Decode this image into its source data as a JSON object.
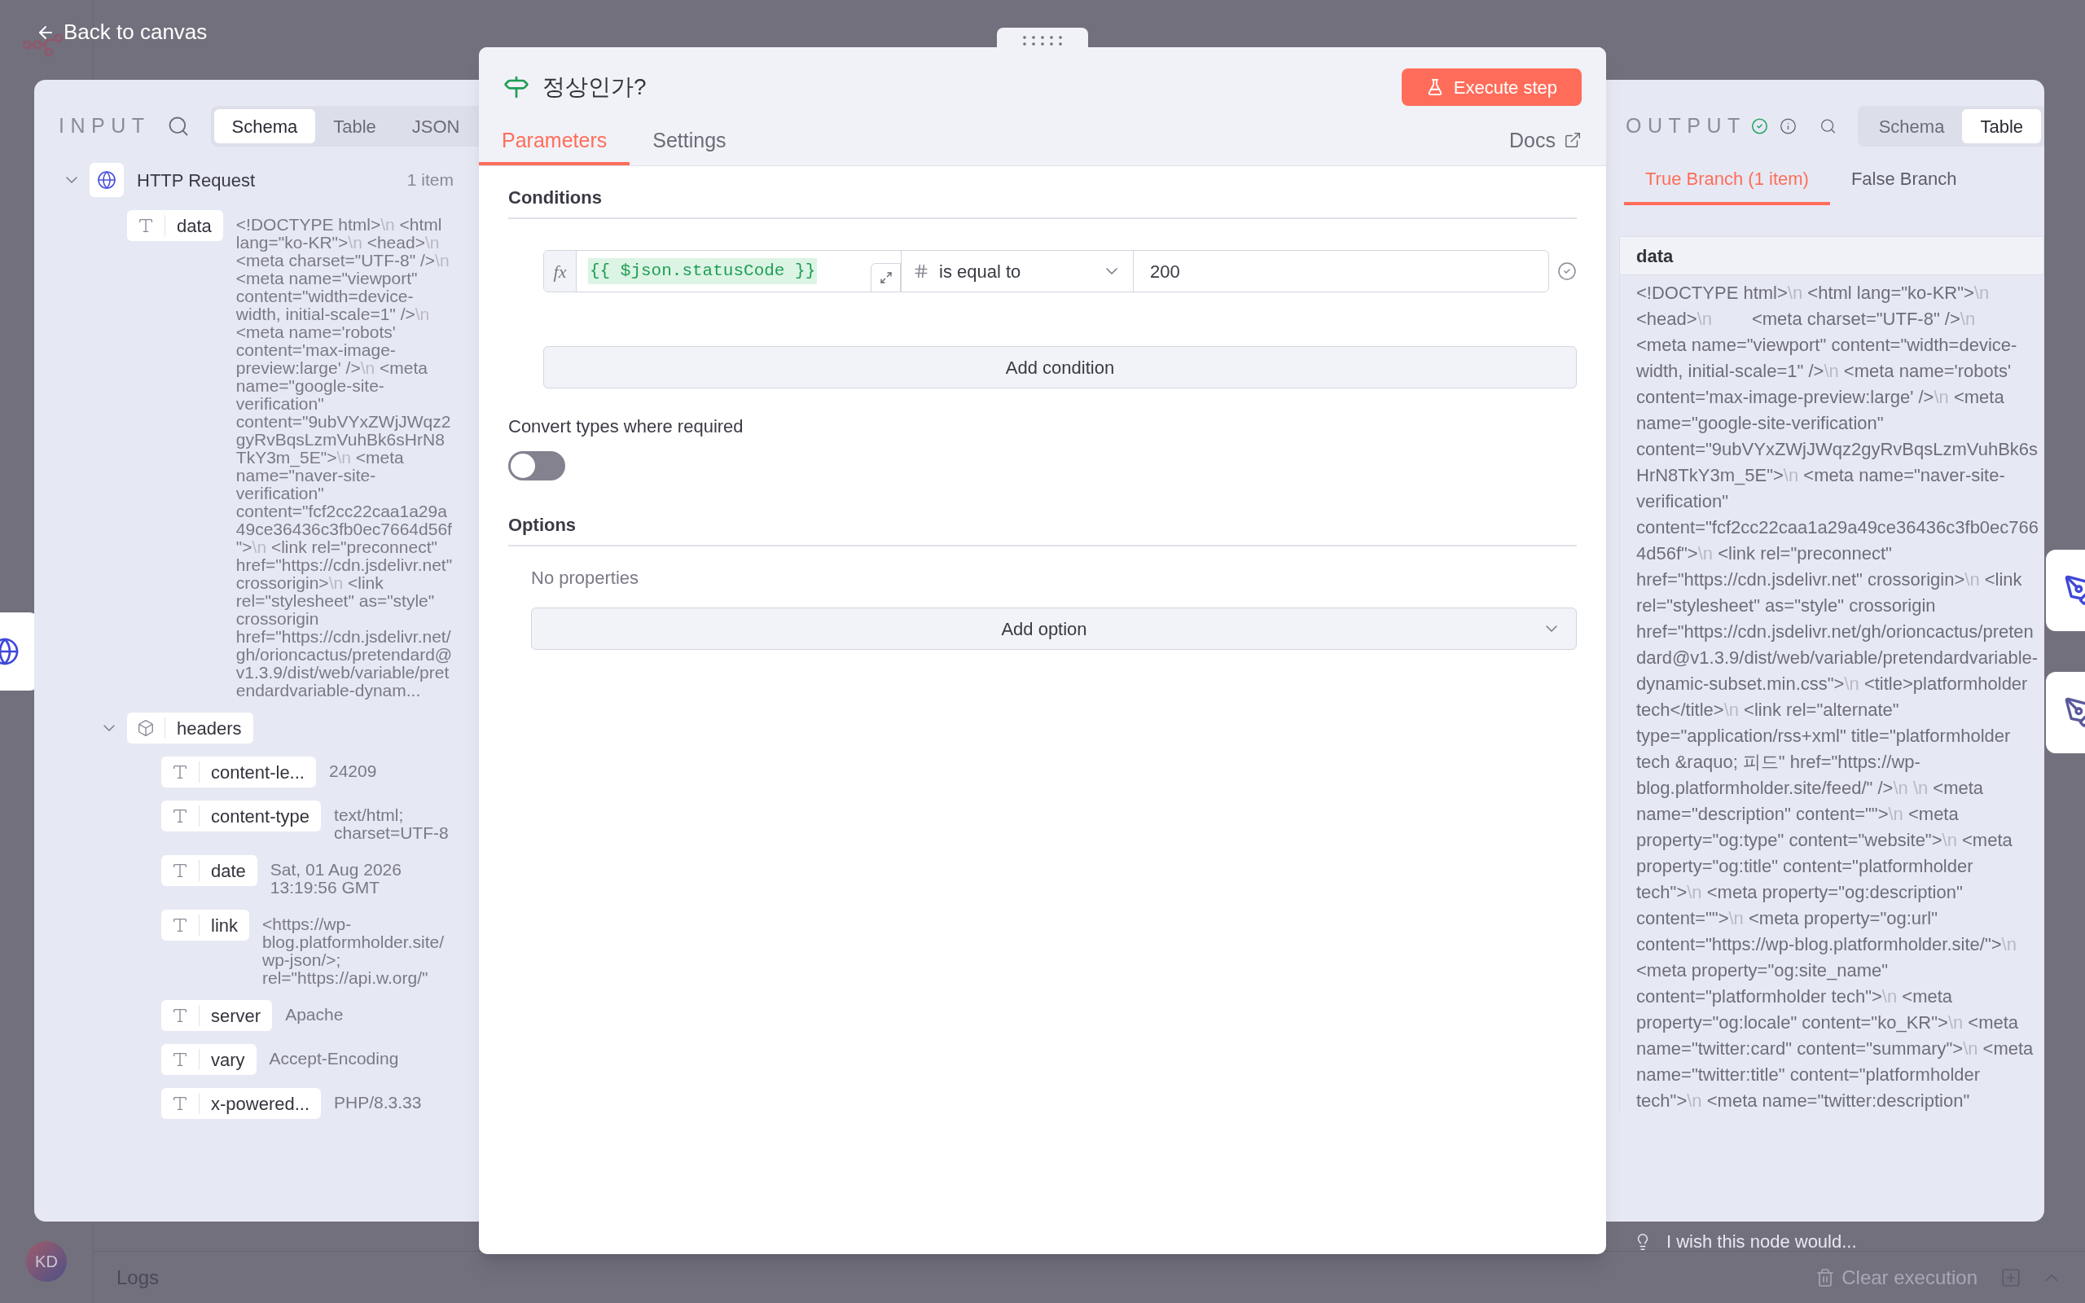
{
  "back_link": "Back to canvas",
  "input_panel": {
    "title": "INPUT",
    "view_tabs": [
      {
        "label": "Schema",
        "selected": true
      },
      {
        "label": "Table",
        "selected": false
      },
      {
        "label": "JSON",
        "selected": false
      }
    ],
    "tree": [
      {
        "kind": "node",
        "label": "HTTP Request",
        "count": "1 item",
        "expanded": true,
        "children": [
          {
            "kind": "text",
            "key": "data",
            "value": "<!DOCTYPE html>\\n <html lang=\"ko-KR\">\\n <head>\\n <meta charset=\"UTF-8\" />\\n <meta name=\"viewport\" content=\"width=device-width, initial-scale=1\" />\\n <meta name='robots' content='max-image-preview:large' />\\n <meta name=\"google-site-verification\" content=\"9ubVYxZWjJWqz2gyRvBqsLzmVuhBk6sHrN8TkY3m_5E\">\\n <meta name=\"naver-site-verification\" content=\"fcf2cc22caa1a29a49ce36436c3fb0ec7664d56f\">\\n <link rel=\"preconnect\" href=\"https://cdn.jsdelivr.net\" crossorigin>\\n <link rel=\"stylesheet\" as=\"style\" crossorigin href=\"https://cdn.jsdelivr.net/gh/orioncactus/pretendard@v1.3.9/dist/web/variable/pretendardvariable-dynam..."
          },
          {
            "kind": "object",
            "key": "headers",
            "expanded": true,
            "children": [
              {
                "kind": "text",
                "key": "content-le...",
                "value": "24209"
              },
              {
                "kind": "text",
                "key": "content-type",
                "value": "text/html; charset=UTF-8"
              },
              {
                "kind": "text",
                "key": "date",
                "value": "Sat, 01 Aug 2026 13:19:56 GMT"
              },
              {
                "kind": "text",
                "key": "link",
                "value": "<https://wp-blog.platformholder.site/wp-json/>; rel=\"https://api.w.org/\""
              },
              {
                "kind": "text",
                "key": "server",
                "value": "Apache"
              },
              {
                "kind": "text",
                "key": "vary",
                "value": "Accept-Encoding"
              },
              {
                "kind": "text",
                "key": "x-powered...",
                "value": "PHP/8.3.33"
              }
            ]
          }
        ]
      }
    ]
  },
  "node_editor": {
    "title": "정상인가?",
    "execute_button": "Execute step",
    "tabs": [
      {
        "label": "Parameters",
        "selected": true
      },
      {
        "label": "Settings",
        "selected": false
      }
    ],
    "docs_link": "Docs",
    "conditions": {
      "heading": "Conditions",
      "rows": [
        {
          "expression_marker": "fx",
          "left_value": "{{ $json.statusCode }}",
          "operator": "is equal to",
          "right_value": "200"
        }
      ],
      "add_button": "Add condition"
    },
    "convert_types": {
      "label": "Convert types where required",
      "on": false
    },
    "options": {
      "heading": "Options",
      "empty_text": "No properties",
      "add_button": "Add option"
    }
  },
  "output_panel": {
    "title": "OUTPUT",
    "view_tabs": [
      {
        "label": "Schema",
        "selected": false
      },
      {
        "label": "Table",
        "selected": true
      }
    ],
    "branch_tabs": [
      {
        "label": "True Branch (1 item)",
        "selected": true
      },
      {
        "label": "False Branch",
        "selected": false
      }
    ],
    "table": {
      "columns": [
        "data"
      ],
      "rows": [
        [
          "<!DOCTYPE html>\\n <html lang=\"ko-KR\">\\n <head>\\n        <meta charset=\"UTF-8\" />\\n        <meta name=\"viewport\" content=\"width=device-width, initial-scale=1\" />\\n <meta name='robots' content='max-image-preview:large' />\\n <meta name=\"google-site-verification\" content=\"9ubVYxZWjJWqz2gyRvBqsLzmVuhBk6sHrN8TkY3m_5E\">\\n <meta name=\"naver-site-verification\" content=\"fcf2cc22caa1a29a49ce36436c3fb0ec7664d56f\">\\n <link rel=\"preconnect\" href=\"https://cdn.jsdelivr.net\" crossorigin>\\n <link rel=\"stylesheet\" as=\"style\" crossorigin href=\"https://cdn.jsdelivr.net/gh/orioncactus/pretendard@v1.3.9/dist/web/variable/pretendardvariable-dynamic-subset.min.css\">\\n <title>platformholder tech</title>\\n <link rel=\"alternate\" type=\"application/rss+xml\" title=\"platformholder tech &raquo; 피드\" href=\"https://wp-blog.platformholder.site/feed/\" />\\n \\n <meta name=\"description\" content=\"\">\\n <meta property=\"og:type\" content=\"website\">\\n <meta property=\"og:title\" content=\"platformholder tech\">\\n <meta property=\"og:description\" content=\"\">\\n <meta property=\"og:url\" content=\"https://wp-blog.platformholder.site/\">\\n <meta property=\"og:site_name\" content=\"platformholder tech\">\\n <meta property=\"og:locale\" content=\"ko_KR\">\\n <meta name=\"twitter:card\" content=\"summary\">\\n <meta name=\"twitter:title\" content=\"platformholder tech\">\\n <meta name=\"twitter:description\""
        ]
      ]
    }
  },
  "feedback_prompt": "I wish this node would...",
  "logs_bar": {
    "title": "Logs",
    "clear_button": "Clear execution"
  },
  "avatar": "KD"
}
